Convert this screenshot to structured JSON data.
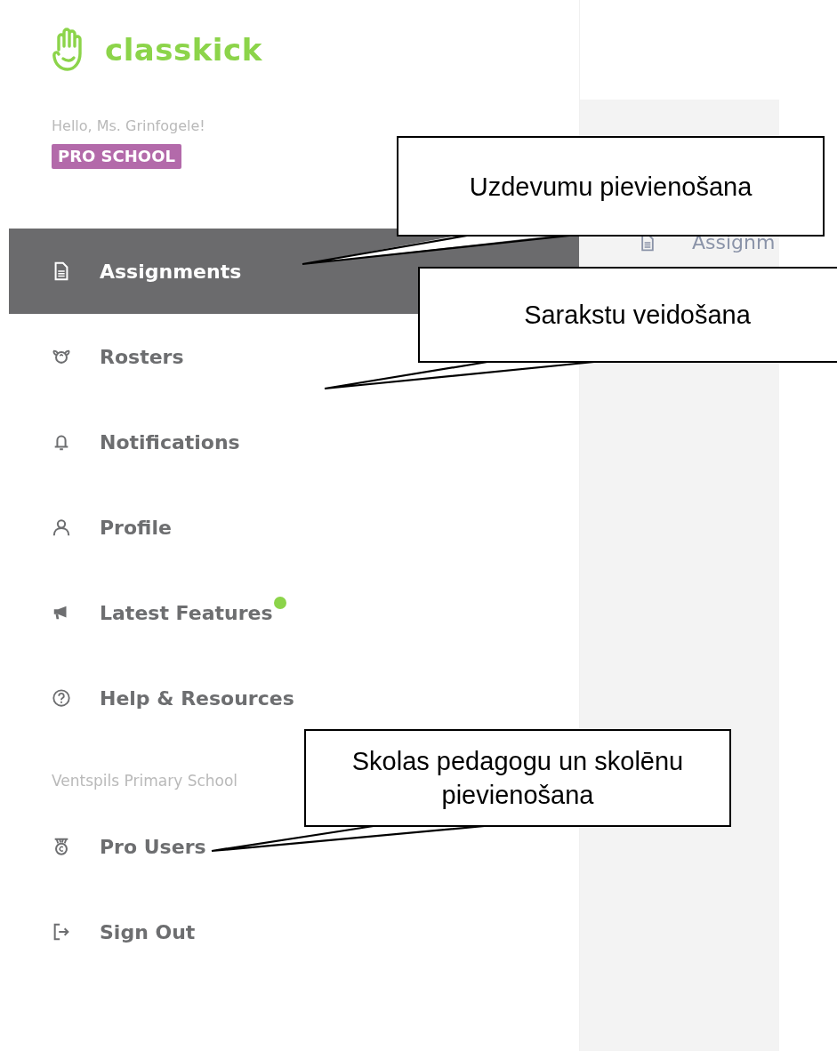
{
  "logo": {
    "text": "classkick"
  },
  "greeting": "Hello, Ms. Grinfogele!",
  "plan_badge": "PRO SCHOOL",
  "nav": [
    {
      "label": "Assignments",
      "kind": "document",
      "selected": true,
      "new": false
    },
    {
      "label": "Rosters",
      "kind": "sheep",
      "selected": false,
      "new": false
    },
    {
      "label": "Notifications",
      "kind": "bell",
      "selected": false,
      "new": false
    },
    {
      "label": "Profile",
      "kind": "person",
      "selected": false,
      "new": false
    },
    {
      "label": "Latest Features",
      "kind": "megaphone",
      "selected": false,
      "new": true
    },
    {
      "label": "Help & Resources",
      "kind": "help",
      "selected": false,
      "new": false
    }
  ],
  "section_label": "Ventspils Primary School",
  "nav_secondary": [
    {
      "label": "Pro Users",
      "kind": "medal",
      "selected": false,
      "new": false
    },
    {
      "label": "Sign Out",
      "kind": "exit",
      "selected": false,
      "new": false
    }
  ],
  "content_panel": {
    "item": {
      "label": "Assignm",
      "kind": "document"
    }
  },
  "callouts": [
    {
      "text": "Uzdevumu pievienošana"
    },
    {
      "text": "Sarakstu veidošana"
    },
    {
      "text": "Skolas pedagogu un skolēnu pievienošana"
    }
  ]
}
